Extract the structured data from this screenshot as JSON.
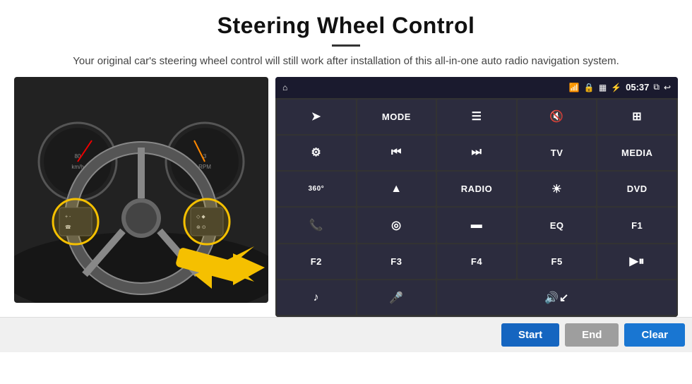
{
  "header": {
    "title": "Steering Wheel Control",
    "subtitle": "Your original car's steering wheel control will still work after installation of this all-in-one auto radio navigation system."
  },
  "status_bar": {
    "time": "05:37",
    "icons": [
      "home",
      "wifi",
      "lock",
      "sim",
      "bluetooth",
      "window",
      "back"
    ]
  },
  "grid_buttons": [
    {
      "id": "row1-c1",
      "type": "icon",
      "icon": "➤",
      "label": "navigate"
    },
    {
      "id": "row1-c2",
      "type": "text",
      "icon": "MODE",
      "label": "mode"
    },
    {
      "id": "row1-c3",
      "type": "icon",
      "icon": "☰",
      "label": "menu"
    },
    {
      "id": "row1-c4",
      "type": "icon",
      "icon": "🔇",
      "label": "mute"
    },
    {
      "id": "row1-c5",
      "type": "icon",
      "icon": "⊞",
      "label": "apps"
    },
    {
      "id": "row2-c1",
      "type": "icon",
      "icon": "⚙",
      "label": "settings"
    },
    {
      "id": "row2-c2",
      "type": "icon",
      "icon": "⏮",
      "label": "prev"
    },
    {
      "id": "row2-c3",
      "type": "icon",
      "icon": "⏭",
      "label": "next"
    },
    {
      "id": "row2-c4",
      "type": "text",
      "icon": "TV",
      "label": "tv"
    },
    {
      "id": "row2-c5",
      "type": "text",
      "icon": "MEDIA",
      "label": "media"
    },
    {
      "id": "row3-c1",
      "type": "icon",
      "icon": "360°",
      "label": "360-camera"
    },
    {
      "id": "row3-c2",
      "type": "icon",
      "icon": "▲",
      "label": "eject"
    },
    {
      "id": "row3-c3",
      "type": "text",
      "icon": "RADIO",
      "label": "radio"
    },
    {
      "id": "row3-c4",
      "type": "icon",
      "icon": "☀",
      "label": "brightness"
    },
    {
      "id": "row3-c5",
      "type": "text",
      "icon": "DVD",
      "label": "dvd"
    },
    {
      "id": "row4-c1",
      "type": "icon",
      "icon": "📞",
      "label": "phone"
    },
    {
      "id": "row4-c2",
      "type": "icon",
      "icon": "☯",
      "label": "navi"
    },
    {
      "id": "row4-c3",
      "type": "icon",
      "icon": "▬",
      "label": "display"
    },
    {
      "id": "row4-c4",
      "type": "text",
      "icon": "EQ",
      "label": "eq"
    },
    {
      "id": "row4-c5",
      "type": "text",
      "icon": "F1",
      "label": "f1"
    },
    {
      "id": "row5-c1",
      "type": "text",
      "icon": "F2",
      "label": "f2"
    },
    {
      "id": "row5-c2",
      "type": "text",
      "icon": "F3",
      "label": "f3"
    },
    {
      "id": "row5-c3",
      "type": "text",
      "icon": "F4",
      "label": "f4"
    },
    {
      "id": "row5-c4",
      "type": "text",
      "icon": "F5",
      "label": "f5"
    },
    {
      "id": "row5-c5",
      "type": "icon",
      "icon": "▶⏸",
      "label": "play-pause"
    },
    {
      "id": "row6-c1",
      "type": "icon",
      "icon": "♪",
      "label": "music"
    },
    {
      "id": "row6-c2",
      "type": "icon",
      "icon": "🎤",
      "label": "microphone"
    },
    {
      "id": "row6-c3",
      "type": "icon",
      "icon": "🔊↙",
      "label": "volume-down",
      "span": 3
    }
  ],
  "bottom_buttons": {
    "start_label": "Start",
    "end_label": "End",
    "clear_label": "Clear"
  }
}
